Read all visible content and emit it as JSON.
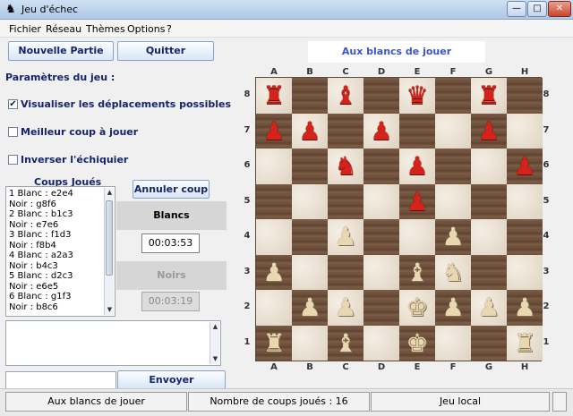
{
  "window": {
    "title": "Jeu d'échec",
    "app_icon": "chess-app-icon",
    "minimize": "—",
    "maximize": "□",
    "close": "✕"
  },
  "menu": [
    "Fichier",
    "Réseau",
    "Thèmes",
    "Options",
    "?"
  ],
  "toolbar": {
    "new_game": "Nouvelle Partie",
    "quit": "Quitter"
  },
  "params": {
    "title": "Paramètres du jeu :",
    "show_moves": {
      "label": "Visualiser les déplacements possibles",
      "checked": true
    },
    "best_move": {
      "label": "Meilleur coup à jouer",
      "checked": false
    },
    "flip_board": {
      "label": "Inverser l'échiquier",
      "checked": false
    }
  },
  "moves": {
    "title": "Coups Joués",
    "lines": [
      "1 Blanc : e2e4",
      "  Noir : g8f6",
      "2 Blanc : b1c3",
      "  Noir : e7e6",
      "3 Blanc : f1d3",
      "  Noir : f8b4",
      "4 Blanc : a2a3",
      "  Noir : b4c3",
      "5 Blanc : d2c3",
      "  Noir : e6e5",
      "6 Blanc : g1f3",
      "  Noir : b8c6"
    ]
  },
  "undo": "Annuler coup",
  "clocks": {
    "white": {
      "label": "Blancs",
      "time": "00:03:53"
    },
    "black": {
      "label": "Noirs",
      "time": "00:03:19"
    }
  },
  "chat": {
    "send": "Envoyer",
    "log": "",
    "input": ""
  },
  "board": {
    "turn": "Aux blancs de jouer",
    "files": [
      "A",
      "B",
      "C",
      "D",
      "E",
      "F",
      "G",
      "H"
    ],
    "ranks": [
      "8",
      "7",
      "6",
      "5",
      "4",
      "3",
      "2",
      "1"
    ],
    "rows": [
      "r.b.q.r.",
      "pp.p..p.",
      "..n.p..p",
      "....p...",
      "..P..P..",
      "P...BN..",
      ".PP.KPPP",
      "R.B.K..R"
    ]
  },
  "status": {
    "turn": "Aux blancs de jouer",
    "count": "Nombre de coups joués : 16",
    "mode": "Jeu local"
  },
  "colors": {
    "red_piece": "#d4231a",
    "white_piece": "#e9d7b4",
    "accent": "#3b55c8"
  }
}
